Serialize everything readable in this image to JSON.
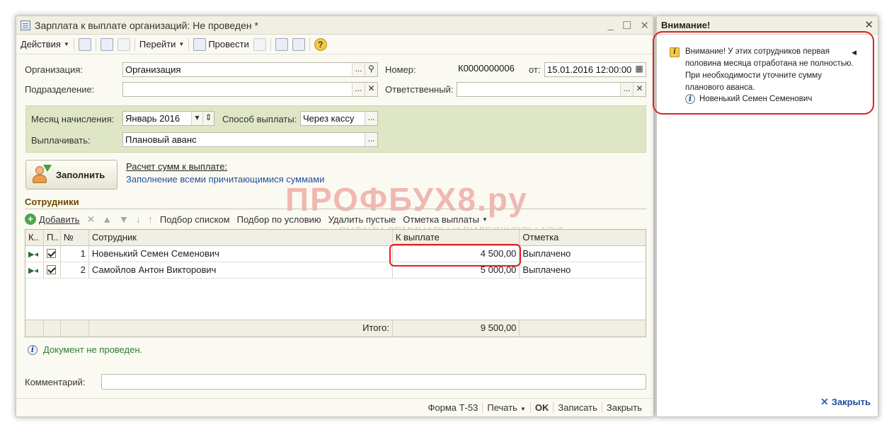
{
  "window": {
    "title": "Зарплата к выплате организаций: Не проведен *",
    "controls": {
      "minimize": "_",
      "maximize": "☐",
      "close": "✕"
    }
  },
  "toolbar": {
    "actions_label": "Действия",
    "goto_label": "Перейти",
    "post_label": "Провести",
    "help_label": "?"
  },
  "header": {
    "organization_label": "Организация:",
    "organization_value": "Организация",
    "number_label": "Номер:",
    "number_value": "К0000000006",
    "date_label": "от:",
    "date_value": "15.01.2016 12:00:00",
    "department_label": "Подразделение:",
    "department_value": "",
    "responsible_label": "Ответственный:",
    "responsible_value": ""
  },
  "params": {
    "month_label": "Месяц начисления:",
    "month_value": "Январь 2016",
    "payment_method_label": "Способ выплаты:",
    "payment_method_value": "Через кассу",
    "pay_label": "Выплачивать:",
    "pay_value": "Плановый аванс"
  },
  "fill": {
    "button_label": "Заполнить",
    "calc_link": "Расчет сумм к выплате:",
    "calc_desc": "Заполнение всеми причитающимися суммами"
  },
  "employees": {
    "section_title": "Сотрудники",
    "toolbar": {
      "add": "Добавить",
      "pick_list": "Подбор списком",
      "pick_condition": "Подбор по условию",
      "delete_empty": "Удалить пустые",
      "mark_payment": "Отметка выплаты"
    },
    "columns": [
      "К..",
      "П..",
      "№",
      "Сотрудник",
      "К выплате",
      "Отметка"
    ],
    "rows": [
      {
        "n": "1",
        "name": "Новенький Семен Семенович",
        "amount": "4 500,00",
        "mark": "Выплачено"
      },
      {
        "n": "2",
        "name": "Самойлов Антон Викторович",
        "amount": "5 000,00",
        "mark": "Выплачено"
      }
    ],
    "total_label": "Итого:",
    "total_value": "9 500,00"
  },
  "status": {
    "text": "Документ не проведен."
  },
  "comment": {
    "label": "Комментарий:",
    "value": ""
  },
  "bottom": {
    "form": "Форма Т-53",
    "print": "Печать",
    "ok": "OK",
    "save": "Записать",
    "close": "Закрыть"
  },
  "watermark": {
    "main": "ПРОФБУХ8.ру",
    "sub": "ОНЛАЙН-СЕМИНАРЫ И ВИДЕОКУРСЫ 1С:8"
  },
  "alert_panel": {
    "title": "Внимание!",
    "message": "Внимание! У этих сотрудников первая половина месяца отработана не полностью. При необходимости уточните сумму планового аванса.",
    "employee": "Новенький Семен Семенович",
    "close_label": "Закрыть"
  },
  "colors": {
    "highlight": "#e02020",
    "panel_green": "#dfe6c6",
    "link_blue": "#1f4fa0",
    "status_green": "#2e7d32"
  }
}
